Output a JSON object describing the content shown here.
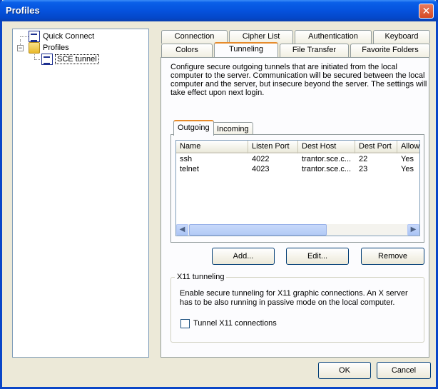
{
  "window": {
    "title": "Profiles",
    "close_glyph": "✕"
  },
  "tree": {
    "items": [
      {
        "label": "Quick Connect",
        "icon": "document-icon"
      },
      {
        "label": "Profiles",
        "icon": "folder-icon",
        "expander": "−"
      },
      {
        "label": "SCE tunnel",
        "icon": "document-icon",
        "selected": true
      }
    ]
  },
  "tabs": {
    "row1": [
      "Connection",
      "Cipher List",
      "Authentication",
      "Keyboard"
    ],
    "row2": [
      "Colors",
      "Tunneling",
      "File Transfer",
      "Favorite Folders"
    ],
    "active": "Tunneling"
  },
  "tunneling": {
    "description": "Configure secure outgoing tunnels that are initiated from the local computer to the server. Communication will be secured between the local computer and the server, but insecure beyond the server. The settings will take effect upon next login.",
    "subtabs": [
      "Outgoing",
      "Incoming"
    ],
    "active_subtab": "Outgoing",
    "columns": [
      "Name",
      "Listen Port",
      "Dest Host",
      "Dest Port",
      "Allow"
    ],
    "rows": [
      {
        "name": "ssh",
        "listen_port": "4022",
        "dest_host": "trantor.sce.c...",
        "dest_port": "22",
        "allow": "Yes"
      },
      {
        "name": "telnet",
        "listen_port": "4023",
        "dest_host": "trantor.sce.c...",
        "dest_port": "23",
        "allow": "Yes"
      }
    ],
    "buttons": {
      "add": "Add...",
      "edit": "Edit...",
      "remove": "Remove"
    },
    "x11": {
      "title": "X11 tunneling",
      "description": "Enable secure tunneling for X11 graphic connections. An X server has to be also running in passive mode on the local computer.",
      "checkbox_label": "Tunnel X11 connections",
      "checked": false
    }
  },
  "footer": {
    "ok": "OK",
    "cancel": "Cancel"
  }
}
